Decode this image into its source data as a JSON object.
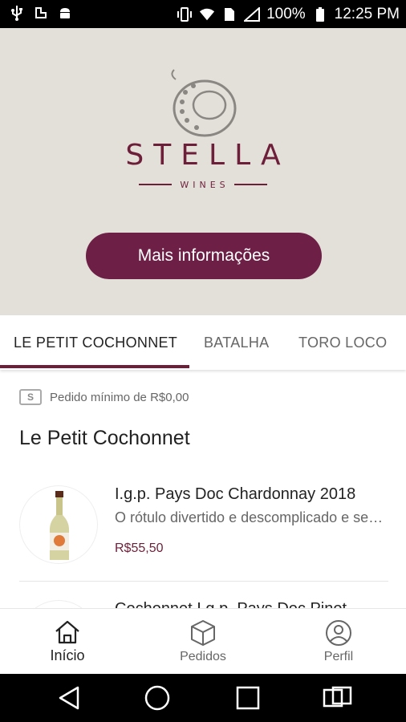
{
  "status_bar": {
    "battery": "100%",
    "time": "12:25 PM"
  },
  "brand": {
    "name": "STELLA",
    "sub": "WINES"
  },
  "hero": {
    "button_label": "Mais informações"
  },
  "tabs": [
    {
      "label": "LE PETIT COCHONNET",
      "active": true
    },
    {
      "label": "BATALHA",
      "active": false
    },
    {
      "label": "TORO LOCO",
      "active": false
    }
  ],
  "content": {
    "min_order": "Pedido mínimo de R$0,00",
    "money_icon": "S",
    "section_title": "Le Petit Cochonnet",
    "products": [
      {
        "name": "I.g.p. Pays Doc Chardonnay 2018",
        "description": "O rótulo divertido e descomplicado e sempre uma boa escolha",
        "price": "R$55,50"
      },
      {
        "name": "Cochonnet I.g.p. Pays Doc Pinot"
      }
    ]
  },
  "bottom_nav": [
    {
      "label": "Início",
      "icon": "home-icon",
      "active": true
    },
    {
      "label": "Pedidos",
      "icon": "box-icon",
      "active": false
    },
    {
      "label": "Perfil",
      "icon": "profile-icon",
      "active": false
    }
  ],
  "colors": {
    "brand": "#6d1f3a",
    "button": "#6d1f46",
    "hero_bg": "#e3e0da"
  }
}
